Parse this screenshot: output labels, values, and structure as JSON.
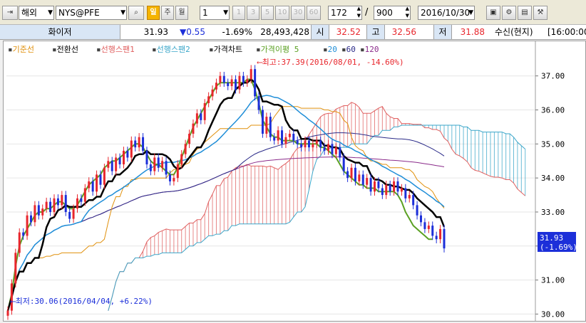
{
  "toolbar": {
    "market": "해외",
    "symbol": "NYS@PFE",
    "period_buttons": [
      "일",
      "주",
      "월"
    ],
    "interval_value": "1",
    "interval_buttons": [
      "1",
      "3",
      "5",
      "10",
      "30",
      "60"
    ],
    "count": "172",
    "total": "900",
    "date": "2016/10/30",
    "icons": [
      "sidebar-toggle-icon",
      "search-icon",
      "window-icon",
      "gear-icon",
      "save-icon",
      "chart-tool-icon"
    ]
  },
  "quote": {
    "name": "화이저",
    "price": "31.93",
    "change": "▼0.55",
    "change_pct": "-1.69%",
    "volume": "28,493,428",
    "open_label": "시",
    "open": "32.52",
    "high_label": "고",
    "high": "32.56",
    "low_label": "저",
    "low": "31.88",
    "status": "수신(현지)",
    "time": "[16:00:00"
  },
  "colors": {
    "up": "#e8262c",
    "down": "#1c2fd9",
    "base": "#e0900c",
    "conv": "#000000",
    "span1": "#e06060",
    "span2": "#3aa6c9",
    "ma5": "#5aa022",
    "ma20": "#1f8ed8",
    "ma60": "#2a2a88",
    "ma120": "#8a2a8a",
    "highlight": "#1c2fd9"
  },
  "chart_data": {
    "type": "candlestick",
    "title": "",
    "legend": [
      "기준선",
      "전환선",
      "선행스팬1",
      "선행스팬2",
      "가격차트",
      "가격이평 5",
      "20",
      "60",
      "120"
    ],
    "y_ticks": [
      "37.00",
      "36.00",
      "35.00",
      "34.00",
      "33.00",
      "32.00",
      "31.00",
      "30.00"
    ],
    "ylim": [
      29.8,
      37.6
    ],
    "annotations": {
      "max_label": "최고:37.39(2016/08/01, -14.60%)",
      "min_label": "최저:30.06(2016/04/04, +6.22%)"
    },
    "last_price_label": [
      "31.93",
      "(-1.69%)"
    ],
    "candles_close": [
      30.1,
      30.9,
      31.8,
      32.4,
      32.3,
      32.9,
      32.7,
      33.2,
      32.9,
      33.1,
      33.3,
      33.0,
      33.4,
      33.2,
      33.5,
      33.0,
      32.8,
      33.1,
      33.4,
      33.3,
      33.7,
      33.9,
      33.6,
      34.1,
      33.8,
      34.3,
      34.5,
      34.2,
      34.6,
      34.4,
      34.8,
      34.6,
      35.1,
      34.9,
      35.2,
      34.8,
      34.4,
      34.2,
      34.6,
      34.3,
      34.5,
      34.1,
      33.9,
      34.0,
      34.4,
      34.7,
      35.0,
      35.3,
      35.6,
      35.9,
      35.7,
      36.2,
      36.4,
      36.6,
      36.8,
      37.0,
      36.8,
      36.7,
      36.9,
      36.6,
      37.0,
      36.8,
      36.9,
      37.2,
      36.4,
      36.0,
      35.3,
      35.8,
      35.2,
      35.1,
      35.4,
      35.0,
      35.2,
      35.3,
      35.1,
      35.0,
      34.9,
      35.1,
      34.9,
      35.0,
      35.1,
      34.9,
      34.8,
      35.0,
      34.7,
      34.9,
      34.6,
      34.2,
      34.0,
      34.3,
      33.9,
      34.1,
      33.8,
      34.0,
      33.6,
      33.9,
      33.7,
      33.5,
      33.8,
      33.6,
      33.9,
      33.6,
      33.7,
      33.4,
      33.5,
      33.2,
      32.9,
      32.7,
      32.5,
      32.6,
      32.3,
      32.2,
      32.5,
      31.93
    ],
    "ma5": [
      30.1,
      30.6,
      31.4,
      32.0,
      32.3,
      32.5,
      32.7,
      32.9,
      33.0,
      33.0,
      33.1,
      33.1,
      33.2,
      33.3,
      33.3,
      33.2,
      33.1,
      33.1,
      33.2,
      33.4,
      33.6,
      33.8,
      33.9,
      34.0,
      34.1,
      34.3,
      34.4,
      34.5,
      34.5,
      34.6,
      34.7,
      34.8,
      34.9,
      35.0,
      35.0,
      34.9,
      34.7,
      34.5,
      34.4,
      34.4,
      34.3,
      34.2,
      34.1,
      34.1,
      34.3,
      34.6,
      34.9,
      35.2,
      35.5,
      35.7,
      35.9,
      36.1,
      36.3,
      36.5,
      36.7,
      36.8,
      36.8,
      36.8,
      36.8,
      36.8,
      36.8,
      36.8,
      36.9,
      36.9,
      36.6,
      36.2,
      35.7,
      35.5,
      35.3,
      35.2,
      35.2,
      35.1,
      35.1,
      35.1,
      35.1,
      35.0,
      35.0,
      35.0,
      35.0,
      35.0,
      35.0,
      34.9,
      34.9,
      34.8,
      34.7,
      34.6,
      34.4,
      34.2,
      34.1,
      34.0,
      33.9,
      33.8,
      33.8,
      33.7,
      33.7,
      33.7,
      33.6,
      33.6,
      33.6,
      33.6,
      33.6,
      33.5,
      33.3,
      33.0,
      32.8,
      32.6,
      32.5,
      32.4,
      32.3,
      32.2,
      32.2
    ]
  }
}
